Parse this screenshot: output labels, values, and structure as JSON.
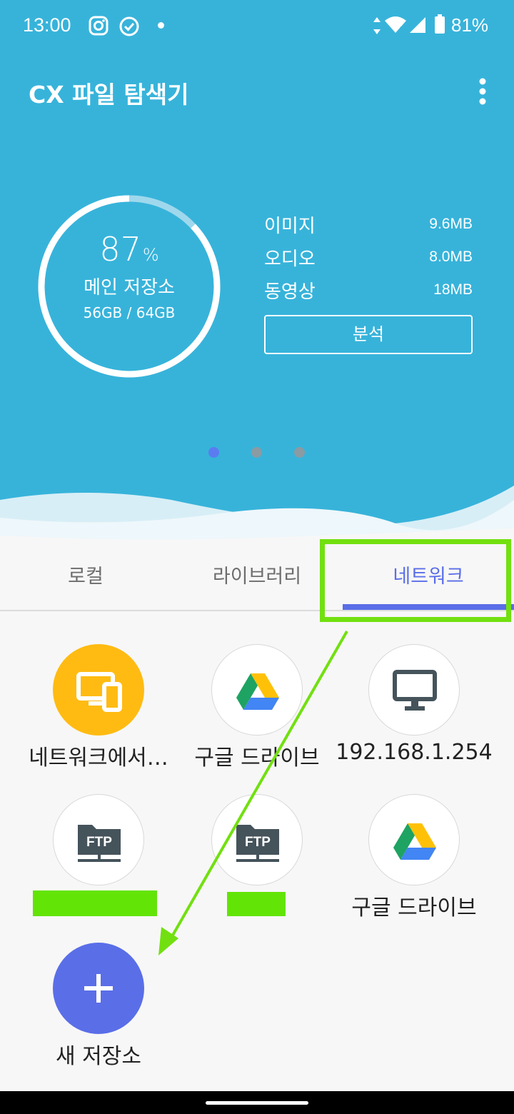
{
  "status_bar": {
    "time": "13:00",
    "battery": "81%",
    "icons": [
      "instagram-icon",
      "check-circle-icon",
      "dot-icon",
      "data-arrows-icon",
      "wifi-icon",
      "signal-icon",
      "battery-icon"
    ]
  },
  "app": {
    "title": "CX 파일 탐색기",
    "menu_icon": "more-vert-icon"
  },
  "storage": {
    "percent": "87",
    "percent_unit": "%",
    "percent_value": 0.87,
    "label": "메인 저장소",
    "size": "56GB / 64GB",
    "stats": [
      {
        "name": "이미지",
        "value": "9.6MB"
      },
      {
        "name": "오디오",
        "value": "8.0MB"
      },
      {
        "name": "동영상",
        "value": "18MB"
      }
    ],
    "analyze_label": "분석",
    "pager_active_index": 0,
    "pager_count": 3
  },
  "tabs": [
    {
      "label": "로컬",
      "active": false
    },
    {
      "label": "라이브러리",
      "active": false
    },
    {
      "label": "네트워크",
      "active": true
    }
  ],
  "network_items": [
    {
      "label": "네트워크에서…",
      "icon": "devices-icon"
    },
    {
      "label": "구글 드라이브",
      "icon": "google-drive-icon"
    },
    {
      "label": "192.168.1.254",
      "icon": "monitor-icon"
    },
    {
      "label": "",
      "icon": "ftp-icon"
    },
    {
      "label": "",
      "icon": "ftp-icon"
    },
    {
      "label": "구글 드라이브",
      "icon": "google-drive-icon"
    },
    {
      "label": "새 저장소",
      "icon": "plus-icon"
    }
  ],
  "colors": {
    "header": "#37b3da",
    "accent": "#5a6ee8",
    "highlight": "#72e010",
    "devices": "#ffbb12"
  }
}
